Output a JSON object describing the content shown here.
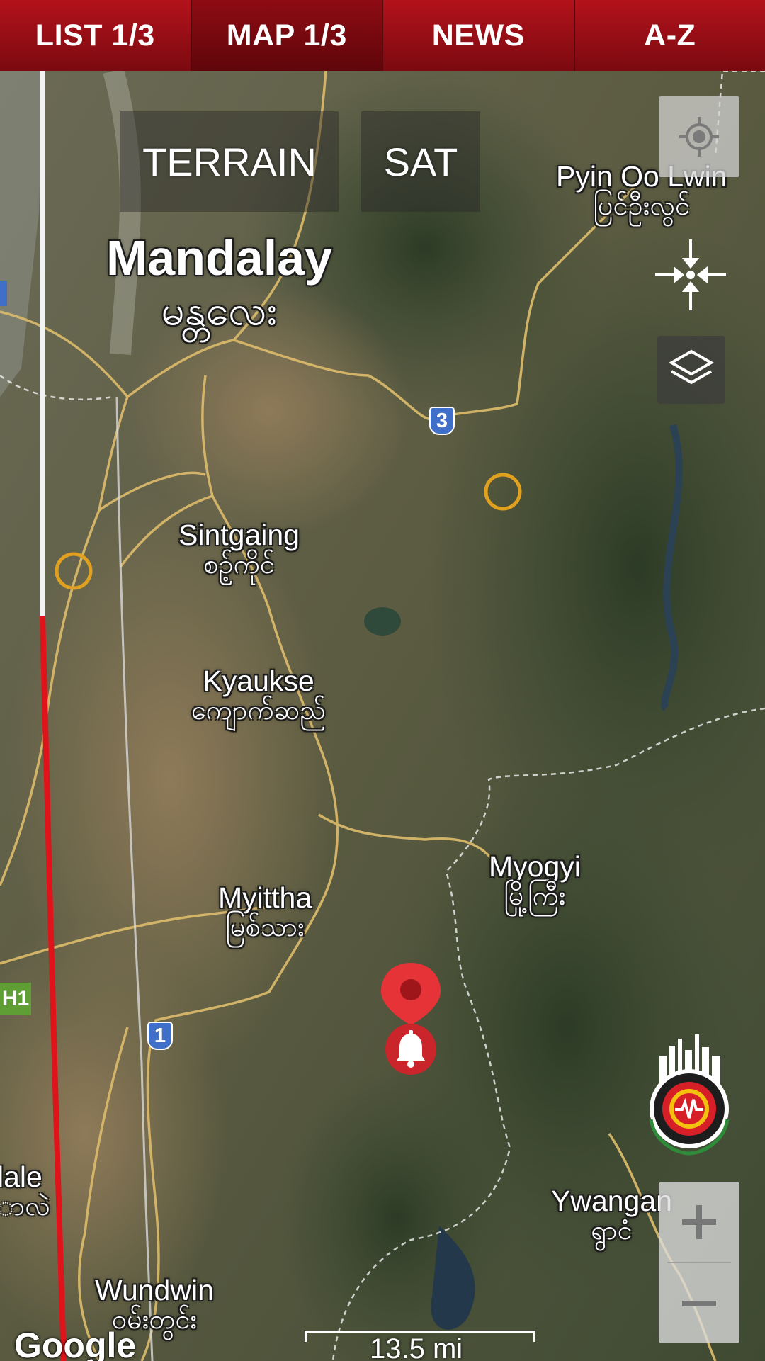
{
  "tabs": [
    {
      "label": "LIST 1/3",
      "active": false
    },
    {
      "label": "MAP 1/3",
      "active": true
    },
    {
      "label": "NEWS",
      "active": false
    },
    {
      "label": "A-Z",
      "active": false
    }
  ],
  "map_type": {
    "terrain": "TERRAIN",
    "sat": "SAT"
  },
  "places": {
    "mandalay": {
      "en": "Mandalay",
      "my": "မန္တလေး"
    },
    "pyin_oo_lwin": {
      "en": "Pyin Oo Lwin",
      "my": "ပြင်ဦးလွင်"
    },
    "sintgaing": {
      "en": "Sintgaing",
      "my": "စဉ့်ကိုင်"
    },
    "kyaukse": {
      "en": "Kyaukse",
      "my": "ကျောက်ဆည်"
    },
    "myogyi": {
      "en": "Myogyi",
      "my": "မြို့ကြီး"
    },
    "myittha": {
      "en": "Myittha",
      "my": "မြစ်သား"
    },
    "ywangan": {
      "en": "Ywangan",
      "my": "ရွာငံ"
    },
    "wundwin": {
      "en": "Wundwin",
      "my": "ဝမ်းတွင်း"
    },
    "nale": {
      "en": "lale",
      "my": "ာလဲ"
    }
  },
  "route_shields": {
    "r3": "3",
    "r1": "1",
    "h1": "H1"
  },
  "scale_label": "13.5 mi",
  "attribution": "Google",
  "icons": {
    "locate": "crosshair-icon",
    "recenter": "recenter-icon",
    "layers": "layers-icon",
    "zoom_in": "plus-icon",
    "zoom_out": "minus-icon",
    "marker": "map-pin-icon",
    "alert": "bell-icon",
    "logo": "earthquake-logo"
  },
  "colors": {
    "tab_bar": "#a5101a",
    "fault_line": "#e0131b",
    "pin": "#e53338",
    "quake_circle": "#e0a020"
  }
}
